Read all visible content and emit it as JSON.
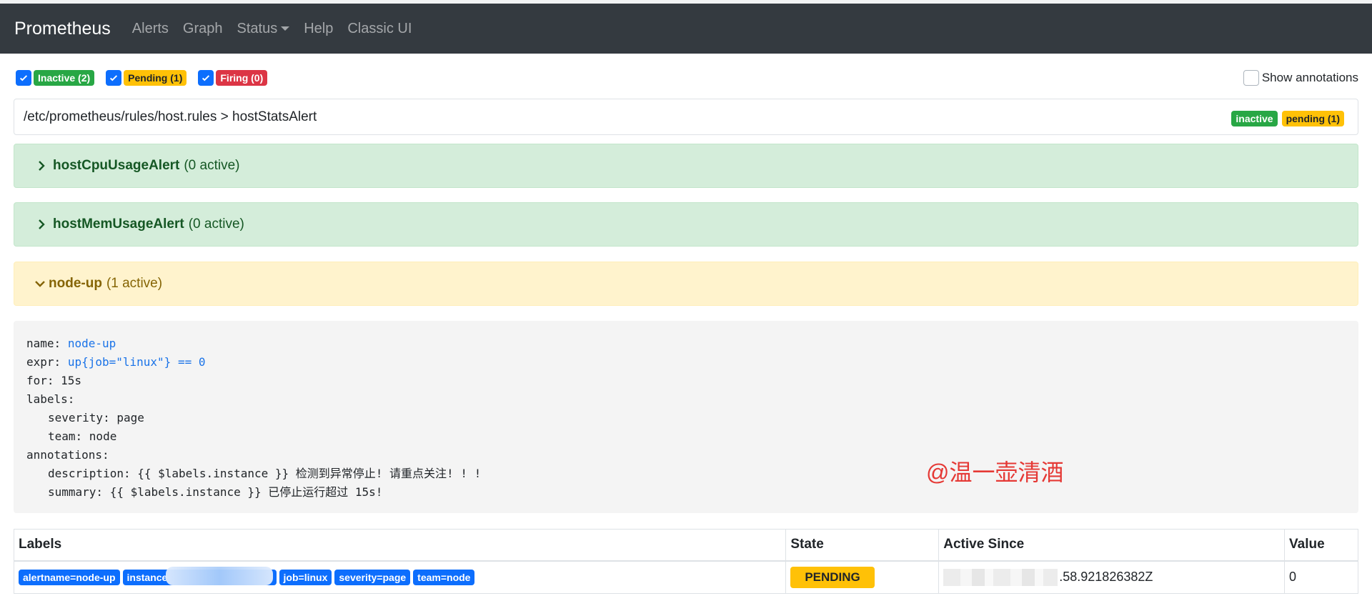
{
  "navbar": {
    "brand": "Prometheus",
    "links": [
      "Alerts",
      "Graph",
      "Status",
      "Help",
      "Classic UI"
    ]
  },
  "filters": [
    {
      "label": "Inactive (2)",
      "checked": true,
      "color": "#28a745"
    },
    {
      "label": "Pending (1)",
      "checked": true,
      "color": "#ffc107"
    },
    {
      "label": "Firing (0)",
      "checked": true,
      "color": "#dc3545"
    }
  ],
  "show_annotations": {
    "label": "Show annotations",
    "checked": false
  },
  "group": {
    "path": "/etc/prometheus/rules/host.rules > hostStatsAlert",
    "badges": [
      "inactive",
      "pending (1)"
    ]
  },
  "rules": [
    {
      "name": "hostCpuUsageAlert",
      "active": "(0 active)",
      "state": "inactive",
      "expanded": false
    },
    {
      "name": "hostMemUsageAlert",
      "active": "(0 active)",
      "state": "inactive",
      "expanded": false
    },
    {
      "name": "node-up",
      "active": "(1 active)",
      "state": "pending",
      "expanded": true
    }
  ],
  "rule_definition": {
    "name_key": "name:",
    "name_value": "node-up",
    "expr_key": "expr:",
    "expr_value": "up{job=\"linux\"} == 0",
    "for_line": "for: 15s",
    "labels_key": "labels:",
    "severity_line": "severity: page",
    "team_line": "team: node",
    "annotations_key": "annotations:",
    "description_line": "description: {{ $labels.instance }} 检测到异常停止! 请重点关注! ! !",
    "summary_line": "summary: {{ $labels.instance }} 已停止运行超过 15s!"
  },
  "watermark": "@温一壶清酒",
  "alerts_table": {
    "headers": [
      "Labels",
      "State",
      "Active Since",
      "Value"
    ],
    "rows": [
      {
        "labels": [
          "alertname=node-up",
          "instance",
          "job=linux",
          "severity=page",
          "team=node"
        ],
        "state": "PENDING",
        "active_since": ".58.921826382Z",
        "value": "0"
      }
    ]
  },
  "colors": {
    "navbar_bg": "#343a40",
    "success": "#28a745",
    "warning": "#ffc107",
    "danger": "#dc3545",
    "primary": "#0d6efd"
  }
}
